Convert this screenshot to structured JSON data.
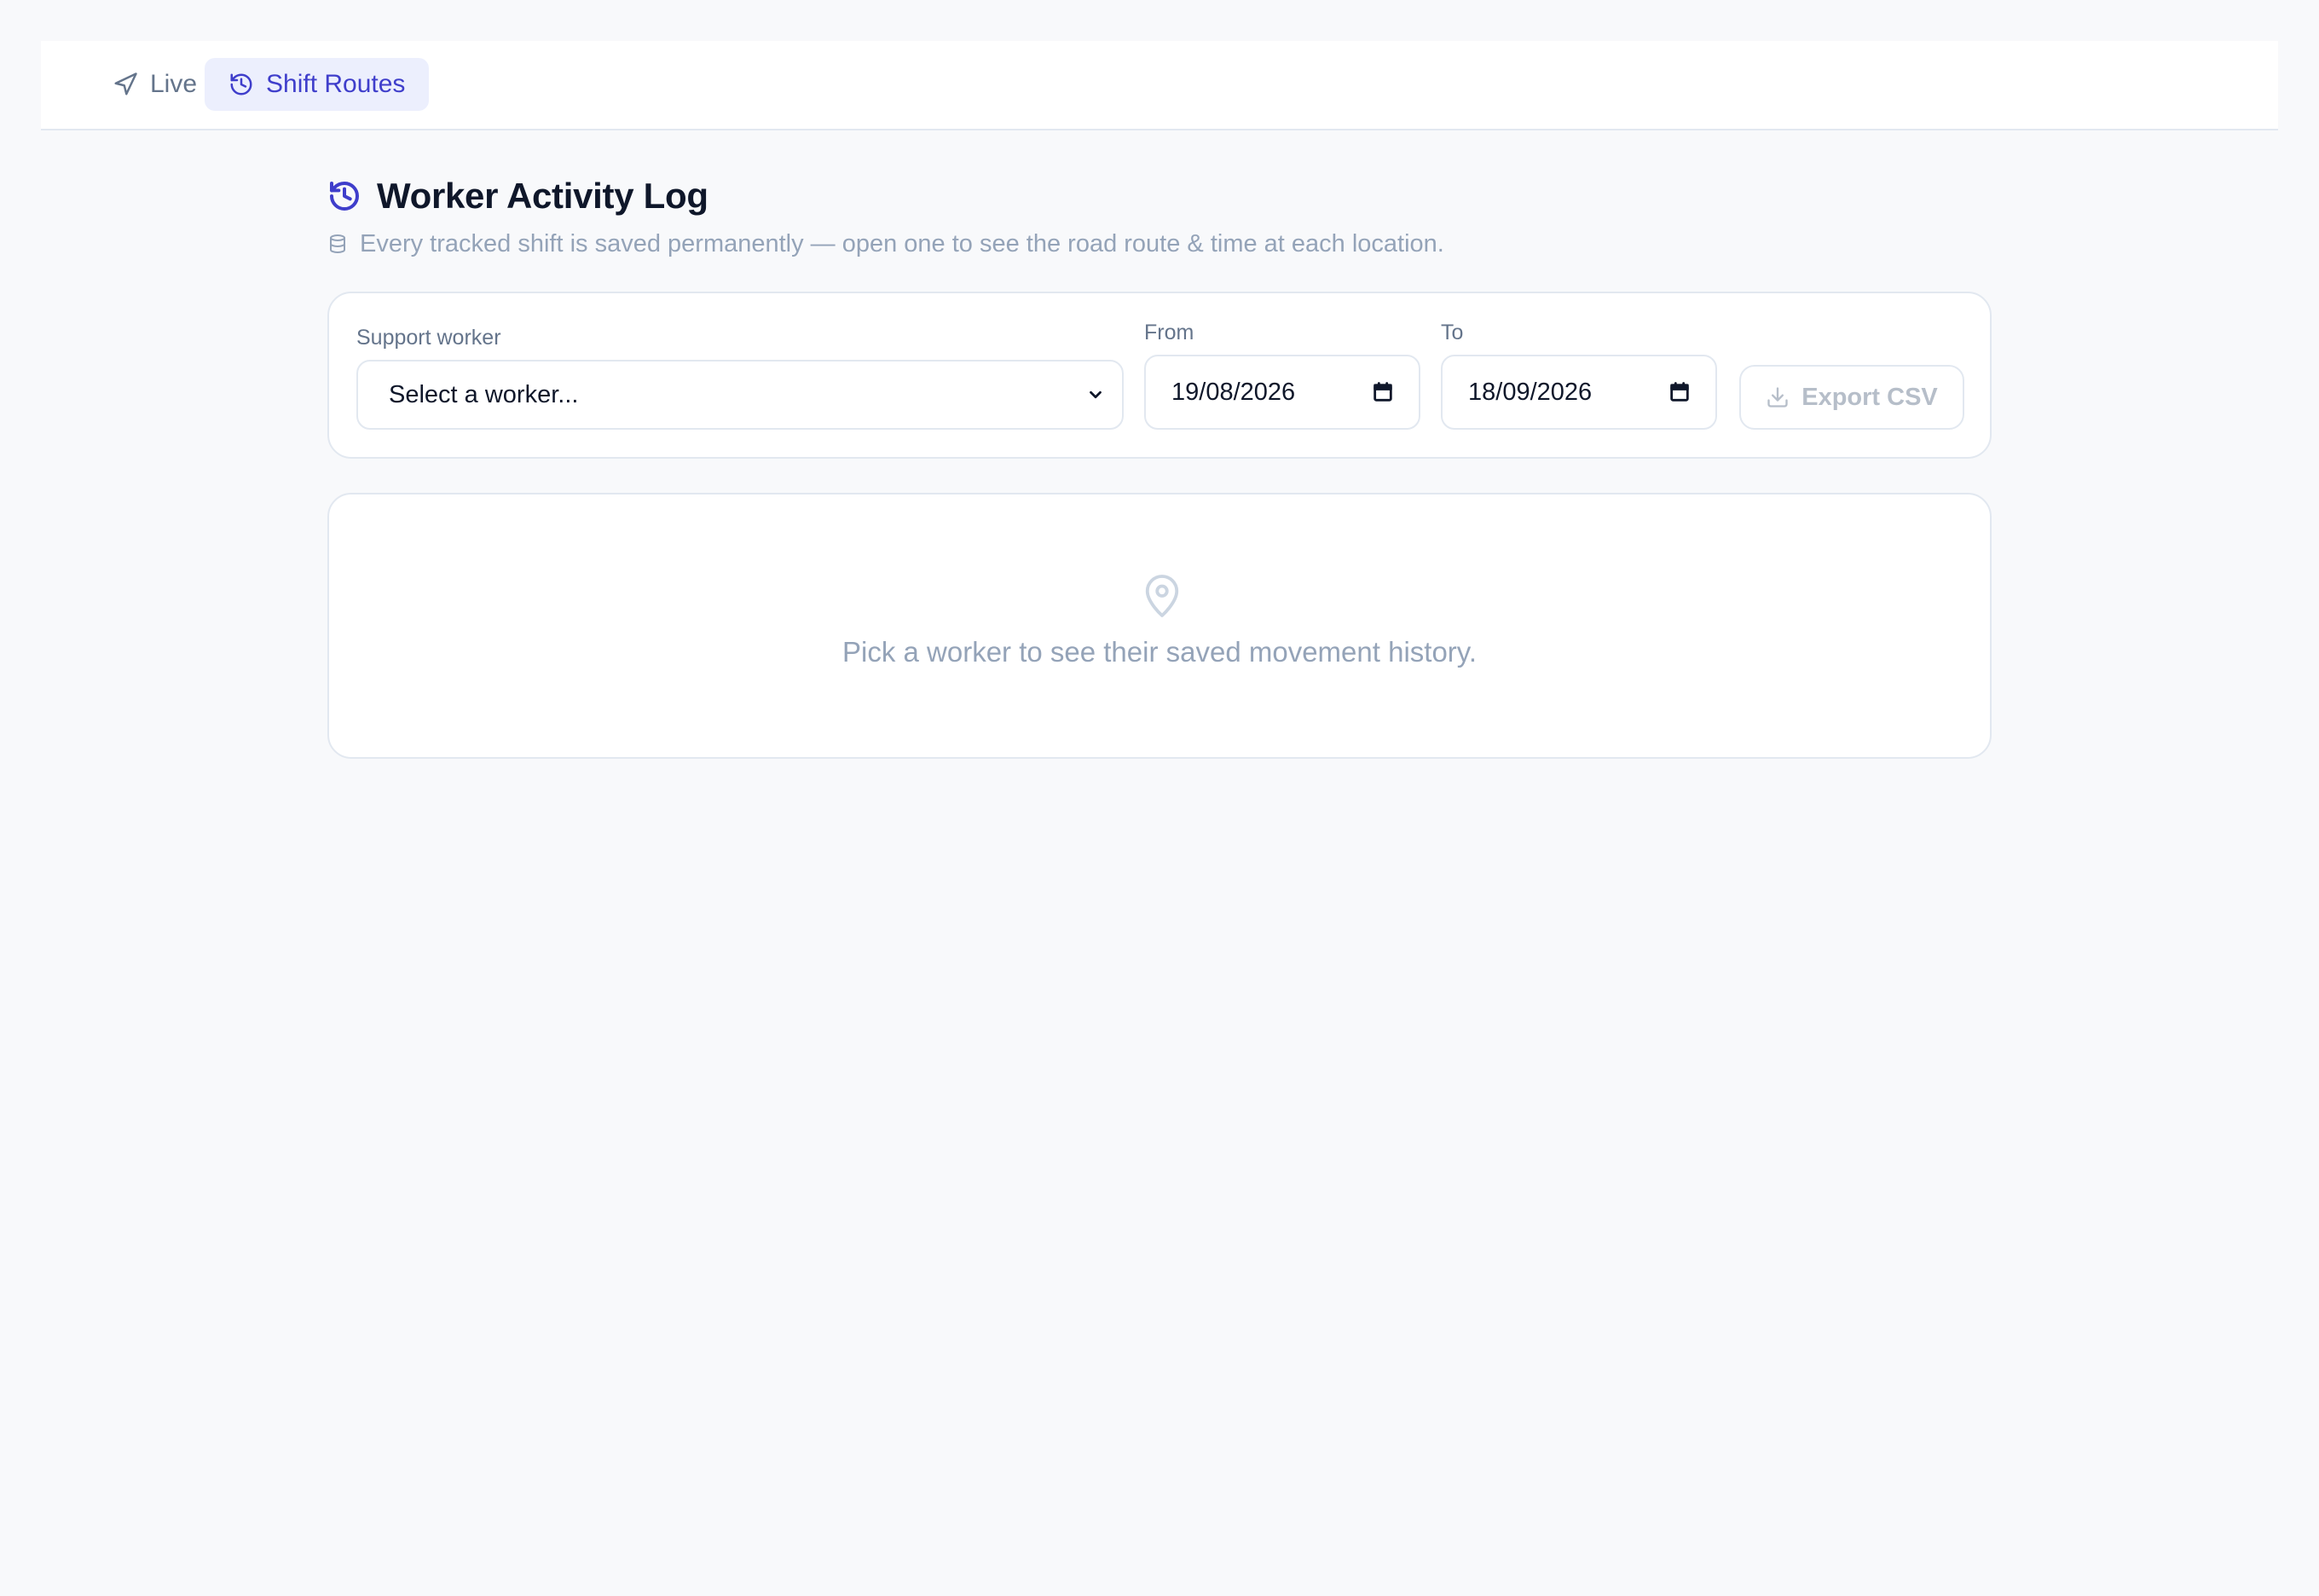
{
  "nav": {
    "tabs": [
      {
        "label": "Live",
        "icon": "navigation-arrow-icon",
        "active": false
      },
      {
        "label": "Shift Routes",
        "icon": "history-icon",
        "active": true
      }
    ]
  },
  "header": {
    "title": "Worker Activity Log",
    "title_icon": "history-icon",
    "subtitle": "Every tracked shift is saved permanently — open one to see the road route & time at each location.",
    "subtitle_icon": "database-icon"
  },
  "filters": {
    "worker_label": "Support worker",
    "worker_value": "Select a worker...",
    "from_label": "From",
    "from_value": "19/08/2026",
    "to_label": "To",
    "to_value": "18/09/2026",
    "export_label": "Export CSV",
    "export_icon": "download-icon"
  },
  "empty_state": {
    "icon": "map-pin-icon",
    "message": "Pick a worker to see their saved movement history."
  },
  "colors": {
    "accent": "#3f3ecb",
    "accent_bg": "#eceffd",
    "muted_text": "#94a3b8",
    "border": "#e2e8f0",
    "page_bg": "#f8f9fb"
  }
}
